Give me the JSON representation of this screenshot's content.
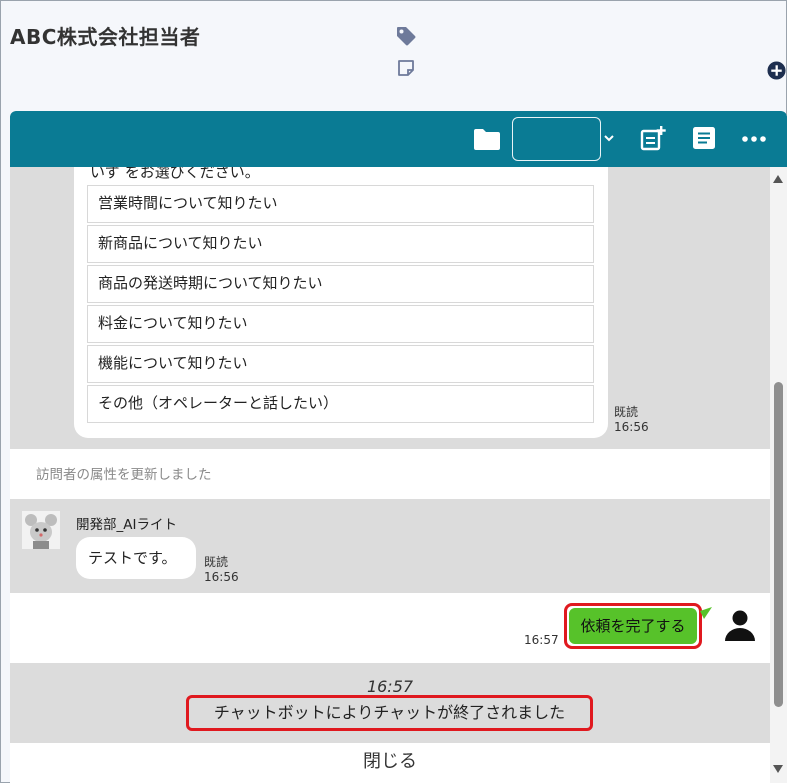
{
  "header": {
    "title": "ABC株式会社担当者",
    "icons": {
      "tag": "tag-icon",
      "note": "sticky-note-icon",
      "add": "plus-circle-icon"
    }
  },
  "toolbar": {
    "icons": [
      "folder-icon",
      "chevron-down-icon",
      "new-note-icon",
      "list-icon",
      "more-icon"
    ],
    "select_value": "",
    "color": "#0a7b94"
  },
  "bot_message": {
    "partial_text": "いず をお選びください。",
    "options": [
      "営業時間について知りたい",
      "新商品について知りたい",
      "商品の発送時期について知りたい",
      "料金について知りたい",
      "機能について知りたい",
      "その他（オペレーターと話したい）"
    ],
    "read_label": "既読",
    "time": "16:56"
  },
  "system_message": "訪問者の属性を更新しました",
  "agent_message": {
    "name": "開発部_AIライト",
    "text": "テストです。",
    "read_label": "既読",
    "time": "16:56"
  },
  "user_message": {
    "text": "依頼を完了する",
    "time": "16:57",
    "bubble_color": "#57c22a",
    "highlight_color": "#e0191f"
  },
  "end_notice": {
    "time": "16:57",
    "text": "チャットボットによりチャットが終了されました"
  },
  "close_button": "閉じる"
}
